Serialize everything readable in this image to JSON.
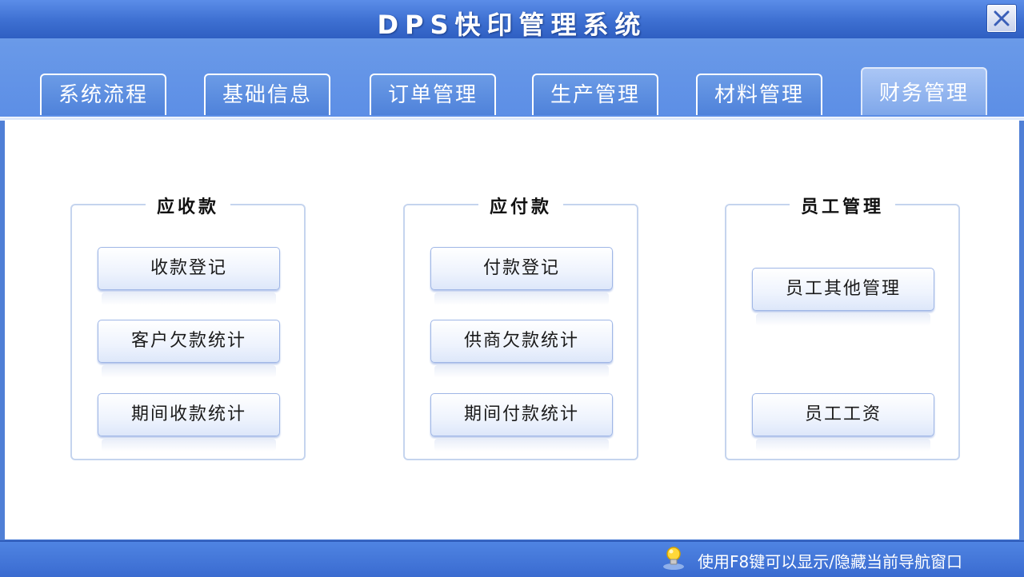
{
  "window": {
    "title": "DPS快印管理系统",
    "close_icon": "close-icon"
  },
  "tabs": [
    {
      "label": "系统流程",
      "active": false
    },
    {
      "label": "基础信息",
      "active": false
    },
    {
      "label": "订单管理",
      "active": false
    },
    {
      "label": "生产管理",
      "active": false
    },
    {
      "label": "材料管理",
      "active": false
    },
    {
      "label": "财务管理",
      "active": true
    }
  ],
  "groups": [
    {
      "title": "应收款",
      "buttons": [
        "收款登记",
        "客户欠款统计",
        "期间收款统计"
      ]
    },
    {
      "title": "应付款",
      "buttons": [
        "付款登记",
        "供商欠款统计",
        "期间付款统计"
      ]
    },
    {
      "title": "员工管理",
      "buttons": [
        "员工其他管理",
        "员工工资"
      ]
    }
  ],
  "status": {
    "icon": "lightbulb-icon",
    "text": "使用F8键可以显示/隐藏当前导航窗口"
  },
  "colors": {
    "frame": "#4f7fd6",
    "active_tab": "#8fb3ef",
    "button_border": "#9fb6e6"
  }
}
